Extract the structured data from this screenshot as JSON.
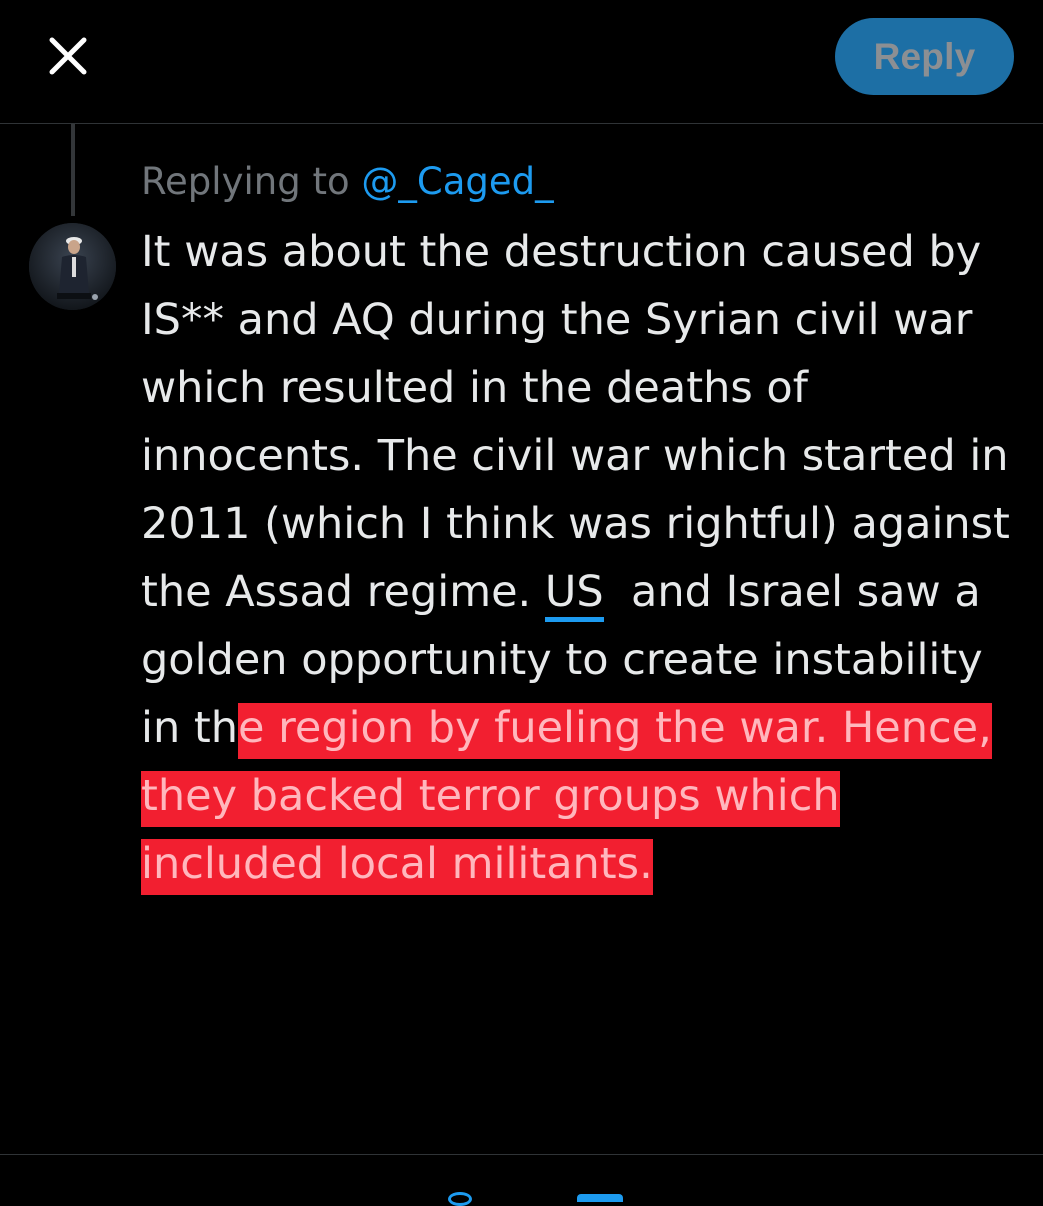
{
  "header": {
    "close_icon": "close-icon",
    "reply_label": "Reply",
    "reply_button_color": "#1d6fa5"
  },
  "reply_context": {
    "prefix": "Replying to",
    "handle": "@_Caged_",
    "handle_color": "#1d9bf0"
  },
  "author": {
    "avatar_icon": "avatar"
  },
  "tweet": {
    "lines": [
      "It was about the destruction caused by",
      "IS** and AQ during the Syrian civil war",
      "which resulted in the deaths of",
      "innocents. The civil war which started in",
      "2011 (which I think was rightful) against"
    ],
    "line6_pre": "the Assad regime. ",
    "line6_link": "US",
    "line6_post": "  and Israel saw a",
    "line7": "golden opportunity to create instability",
    "line8_plain": "in th",
    "line8_highlight": "e region by fueling the war. Hence,",
    "line9_highlight": "they backed terror groups which",
    "line10_highlight": "included local militants.",
    "highlight_color": "#f21f30"
  },
  "toolbar": {
    "icons": [
      "media-icon",
      "gif-icon"
    ]
  }
}
